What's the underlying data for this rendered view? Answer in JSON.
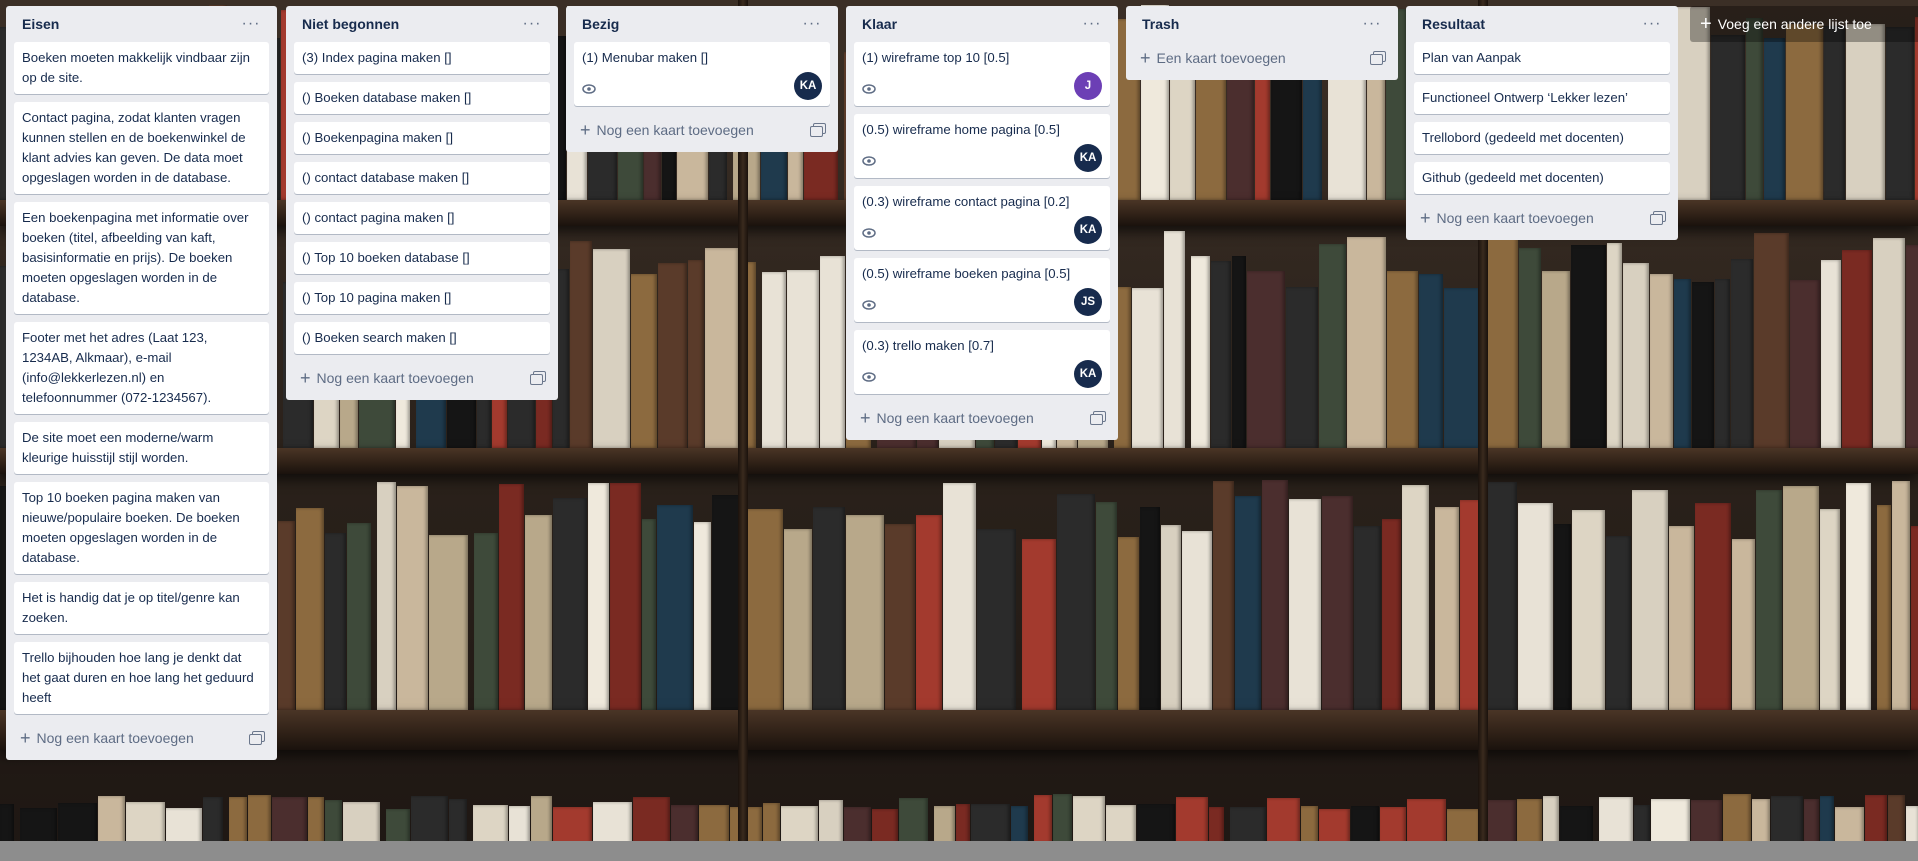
{
  "colors": {
    "list_bg": "#ebecf0",
    "avatar_dark": "#172b4d",
    "avatar_purple": "#6c3fb5"
  },
  "icons": {
    "more": "ellipsis-icon",
    "add": "plus-icon",
    "template": "card-template-icon",
    "watch": "eye-icon"
  },
  "board": {
    "add_list_label": "Voeg een andere lijst toe",
    "lists": [
      {
        "title": "Eisen",
        "cards": [
          "Boeken moeten makkelijk vindbaar zijn op de site.",
          "Contact pagina, zodat klanten vragen kunnen stellen en de boekenwinkel de klant advies kan geven. De data moet opgeslagen worden in de database.",
          "Een boekenpagina met informatie over boeken (titel, afbeelding van kaft, basisinformatie en prijs). De boeken moeten opgeslagen worden in de database.",
          "Footer met het adres (Laat 123, 1234AB, Alkmaar), e-mail (info@lekkerlezen.nl) en telefoonnummer (072-1234567).",
          "De site moet een moderne/warm kleurige huisstijl stijl worden.",
          "Top 10 boeken pagina maken van nieuwe/populaire boeken. De boeken moeten opgeslagen worden in de database.",
          "Het is handig dat je op titel/genre kan zoeken.",
          "Trello bijhouden hoe lang je denkt dat het gaat duren en hoe lang het geduurd heeft"
        ],
        "add_label": "Nog een kaart toevoegen"
      },
      {
        "title": "Niet begonnen",
        "cards": [
          "(3) Index pagina maken []",
          "() Boeken database maken []",
          "() Boekenpagina maken []",
          "() contact database maken []",
          "() contact pagina maken []",
          "() Top 10 boeken database []",
          "() Top 10 pagina maken []",
          "() Boeken search maken []"
        ],
        "add_label": "Nog een kaart toevoegen"
      },
      {
        "title": "Bezig",
        "cards": [
          {
            "text": "(1) Menubar maken []",
            "avatar": "KA"
          }
        ],
        "add_label": "Nog een kaart toevoegen"
      },
      {
        "title": "Klaar",
        "cards": [
          {
            "text": "(1) wireframe top 10 [0.5]",
            "avatar": "J"
          },
          {
            "text": "(0.5) wireframe home pagina [0.5]",
            "avatar": "KA"
          },
          {
            "text": "(0.3) wireframe contact pagina [0.2]",
            "avatar": "KA"
          },
          {
            "text": "(0.5) wireframe boeken pagina [0.5]",
            "avatar": "JS"
          },
          {
            "text": "(0.3) trello maken [0.7]",
            "avatar": "KA"
          }
        ],
        "add_label": "Nog een kaart toevoegen"
      },
      {
        "title": "Trash",
        "cards": [],
        "add_label": "Een kaart toevoegen"
      },
      {
        "title": "Resultaat",
        "cards": [
          "Plan van Aanpak",
          "Functioneel Ontwerp ‘Lekker lezen’",
          "Trellobord (gedeeld met docenten)",
          "Github (gedeeld met docenten)"
        ],
        "add_label": "Nog een kaart toevoegen"
      }
    ]
  }
}
